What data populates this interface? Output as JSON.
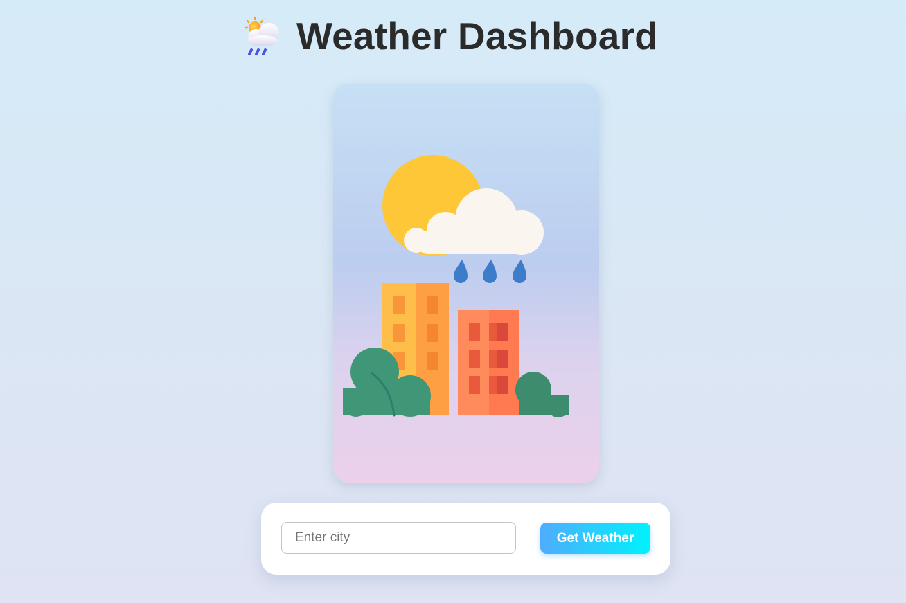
{
  "header": {
    "icon": "sun-behind-rain-cloud-icon",
    "title": "Weather Dashboard"
  },
  "illustration": {
    "icon": "sun-cloud-rain-city-illustration"
  },
  "search": {
    "placeholder": "Enter city",
    "value": "",
    "button_label": "Get Weather"
  },
  "colors": {
    "accent_gradient_start": "#4facfe",
    "accent_gradient_end": "#00f2fe",
    "title_text": "#2b2b2b",
    "sun": "#fec737",
    "cloud": "#faf6ef",
    "rain": "#3d7cc9",
    "building_left": "#ffb347",
    "building_right": "#ff7f57",
    "bush": "#3f9777"
  }
}
